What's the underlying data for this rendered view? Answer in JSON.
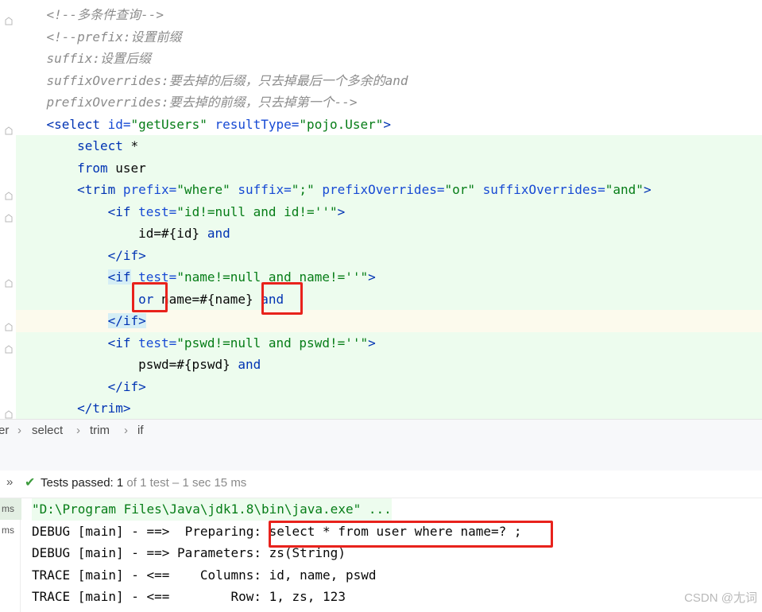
{
  "editor": {
    "lines": [
      {
        "tokens": [
          {
            "t": "    <!--多条件查询-->",
            "c": "cm"
          }
        ],
        "bg": ""
      },
      {
        "tokens": [
          {
            "t": "    <!--prefix:设置前缀",
            "c": "cm"
          }
        ],
        "bg": ""
      },
      {
        "tokens": [
          {
            "t": "    suffix:设置后缀",
            "c": "cm"
          }
        ],
        "bg": ""
      },
      {
        "tokens": [
          {
            "t": "    suffixOverrides:要去掉的后缀，只去掉最后一个多余的and",
            "c": "cm"
          }
        ],
        "bg": ""
      },
      {
        "tokens": [
          {
            "t": "    prefixOverrides:要去掉的前缀，只去掉第一个-->",
            "c": "cm"
          }
        ],
        "bg": ""
      },
      {
        "tokens": [
          {
            "t": "    ",
            "c": "tx"
          },
          {
            "t": "<select ",
            "c": "tg"
          },
          {
            "t": "id=",
            "c": "at"
          },
          {
            "t": "\"getUsers\"",
            "c": "st"
          },
          {
            "t": " resultType=",
            "c": "at"
          },
          {
            "t": "\"pojo.User\"",
            "c": "st"
          },
          {
            "t": ">",
            "c": "tg"
          }
        ],
        "bg": ""
      },
      {
        "tokens": [
          {
            "t": "        ",
            "c": "tx"
          },
          {
            "t": "select",
            "c": "kw"
          },
          {
            "t": " *",
            "c": "tx"
          }
        ],
        "bg": "green"
      },
      {
        "tokens": [
          {
            "t": "        ",
            "c": "tx"
          },
          {
            "t": "from",
            "c": "kw"
          },
          {
            "t": " user",
            "c": "tx"
          }
        ],
        "bg": "green"
      },
      {
        "tokens": [
          {
            "t": "        ",
            "c": "tx"
          },
          {
            "t": "<trim ",
            "c": "tg"
          },
          {
            "t": "prefix=",
            "c": "at"
          },
          {
            "t": "\"where\"",
            "c": "st"
          },
          {
            "t": " suffix=",
            "c": "at"
          },
          {
            "t": "\";\"",
            "c": "st"
          },
          {
            "t": " prefixOverrides=",
            "c": "at"
          },
          {
            "t": "\"or\"",
            "c": "st"
          },
          {
            "t": " suffixOverrides=",
            "c": "at"
          },
          {
            "t": "\"and\"",
            "c": "st"
          },
          {
            "t": ">",
            "c": "tg"
          }
        ],
        "bg": "green"
      },
      {
        "tokens": [
          {
            "t": "            ",
            "c": "tx"
          },
          {
            "t": "<if ",
            "c": "tg"
          },
          {
            "t": "test=",
            "c": "at"
          },
          {
            "t": "\"id!=null and id!=''\"",
            "c": "st"
          },
          {
            "t": ">",
            "c": "tg"
          }
        ],
        "bg": "green"
      },
      {
        "tokens": [
          {
            "t": "                id=#{id} ",
            "c": "tx"
          },
          {
            "t": "and",
            "c": "kw"
          }
        ],
        "bg": "green"
      },
      {
        "tokens": [
          {
            "t": "            ",
            "c": "tx"
          },
          {
            "t": "</if>",
            "c": "tg"
          }
        ],
        "bg": "green"
      },
      {
        "tokens": [
          {
            "t": "            ",
            "c": "tx"
          },
          {
            "t": "<if",
            "c": "tg hl"
          },
          {
            "t": " ",
            "c": "tx"
          },
          {
            "t": "test=",
            "c": "at"
          },
          {
            "t": "\"name!=null and name!=''\"",
            "c": "st"
          },
          {
            "t": ">",
            "c": "tg"
          }
        ],
        "bg": "green"
      },
      {
        "tokens": [
          {
            "t": "                ",
            "c": "tx"
          },
          {
            "t": "or",
            "c": "kw"
          },
          {
            "t": " name=#{name} ",
            "c": "tx"
          },
          {
            "t": "and",
            "c": "kw"
          }
        ],
        "bg": "green"
      },
      {
        "tokens": [
          {
            "t": "            ",
            "c": "tx"
          },
          {
            "t": "</if>",
            "c": "tg hl"
          }
        ],
        "bg": "caretline"
      },
      {
        "tokens": [
          {
            "t": "            ",
            "c": "tx"
          },
          {
            "t": "<if ",
            "c": "tg"
          },
          {
            "t": "test=",
            "c": "at"
          },
          {
            "t": "\"pswd!=null and pswd!=''\"",
            "c": "st"
          },
          {
            "t": ">",
            "c": "tg"
          }
        ],
        "bg": "green"
      },
      {
        "tokens": [
          {
            "t": "                pswd=#{pswd} ",
            "c": "tx"
          },
          {
            "t": "and",
            "c": "kw"
          }
        ],
        "bg": "green"
      },
      {
        "tokens": [
          {
            "t": "            ",
            "c": "tx"
          },
          {
            "t": "</if>",
            "c": "tg"
          }
        ],
        "bg": "green"
      },
      {
        "tokens": [
          {
            "t": "        ",
            "c": "tx"
          },
          {
            "t": "</trim>",
            "c": "tg"
          }
        ],
        "bg": "green"
      }
    ]
  },
  "breadcrumb": {
    "items": [
      "er",
      "select",
      "trim",
      "if"
    ],
    "separator": "›"
  },
  "tests": {
    "expand_icon": "»",
    "check_icon": "✔",
    "label": "Tests passed: ",
    "passed": "1",
    "detail": " of 1 test – 1 sec 15 ms"
  },
  "console": {
    "left_labels": [
      "ms",
      "ms"
    ],
    "lines": [
      {
        "text": "\"D:\\Program Files\\Java\\jdk1.8\\bin\\java.exe\" ...",
        "color": "#067d17",
        "bg": "#edfcee"
      },
      {
        "text": "DEBUG [main] - ==>  Preparing: select * from user where name=? ;",
        "color": "#080808",
        "bg": ""
      },
      {
        "text": "DEBUG [main] - ==> Parameters: zs(String)",
        "color": "#080808",
        "bg": ""
      },
      {
        "text": "TRACE [main] - <==    Columns: id, name, pswd",
        "color": "#080808",
        "bg": ""
      },
      {
        "text": "TRACE [main] - <==        Row: 1, zs, 123",
        "color": "#080808",
        "bg": ""
      }
    ]
  },
  "watermark": "CSDN @尢词",
  "colors": {
    "highlight_box": "#e8221c",
    "changed_line": "#edfcee",
    "caret_line": "#fcfaed",
    "pass_green": "#3d9b3d"
  }
}
